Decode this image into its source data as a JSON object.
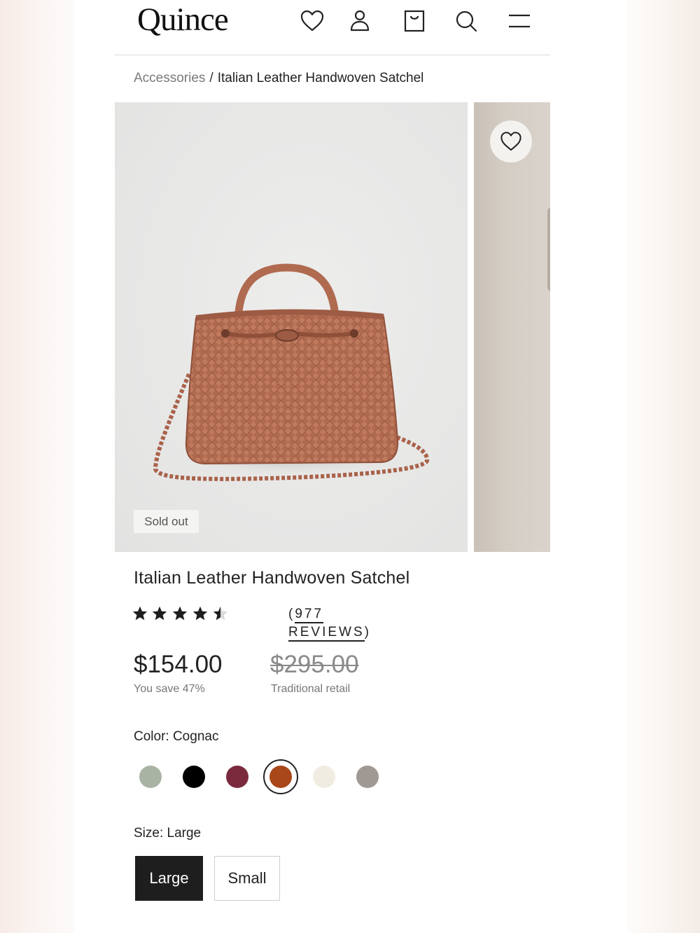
{
  "brand": {
    "logo_text": "Quince"
  },
  "header": {
    "icons": [
      "heart-icon",
      "user-icon",
      "shopping-bag-icon",
      "search-icon",
      "menu-icon"
    ]
  },
  "breadcrumb": {
    "parent": "Accessories",
    "separator": "/",
    "current": "Italian Leather Handwoven Satchel"
  },
  "gallery": {
    "badge": "Sold out",
    "favorite_icon": "heart-icon"
  },
  "product": {
    "title": "Italian Leather Handwoven Satchel",
    "rating": 4.5,
    "rating_max": 5,
    "reviews_text": "(977 REVIEWS)",
    "reviews_link_text": "977 REVIEWS",
    "price": "$154.00",
    "savings": "You save 47%",
    "retail_price": "$295.00",
    "retail_label": "Traditional retail"
  },
  "color": {
    "label": "Color: Cognac",
    "selected_index": 3,
    "swatches": [
      "#a9b3a4",
      "#000000",
      "#7b2a3d",
      "#a9471a",
      "#f1ece2",
      "#9f9893"
    ]
  },
  "size": {
    "label": "Size: Large",
    "options": [
      "Large",
      "Small"
    ],
    "selected": "Large"
  },
  "colors": {
    "accent_dark": "#1e1e1e",
    "bag_leather": "#b56c51"
  }
}
